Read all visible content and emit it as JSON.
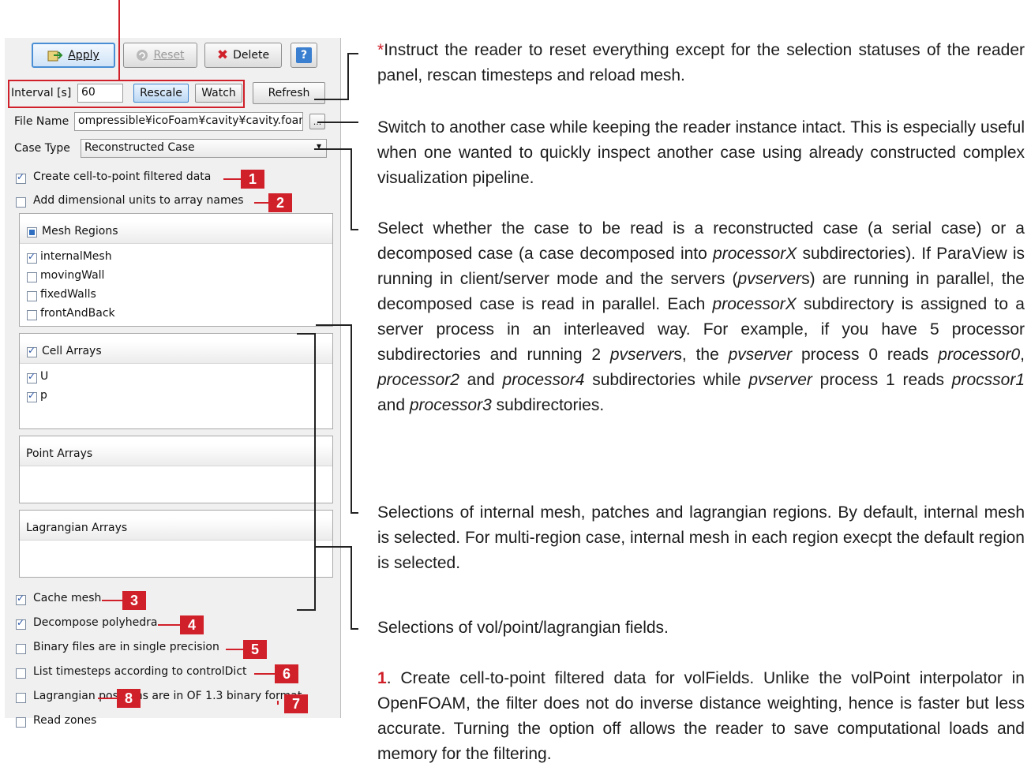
{
  "colors": {
    "accent_red": "#d0202a",
    "select_blue": "#3f86cf",
    "panel_bg": "#f0f0f0"
  },
  "toolbar": {
    "apply_label": "Apply",
    "reset_label": "Reset",
    "delete_label": "Delete",
    "help_label": "?"
  },
  "interval": {
    "label": "Interval [s]",
    "value": "60",
    "rescale_label": "Rescale",
    "watch_label": "Watch"
  },
  "refresh_label": "Refresh",
  "file": {
    "label": "File Name",
    "value": "ompressible¥icoFoam¥cavity¥cavity.foam",
    "browse_label": "..."
  },
  "case_type": {
    "label": "Case Type",
    "value": "Reconstructed Case"
  },
  "options": {
    "cell_to_point": "Create cell-to-point filtered data",
    "dim_units": "Add dimensional units to array names",
    "cache_mesh": "Cache mesh",
    "decompose_poly": "Decompose polyhedra",
    "binary_single": "Binary files are in single precision",
    "list_timesteps": "List timesteps according to controlDict",
    "lagrangian_positions": "Lagrangian positions are in OF 1.3 binary format",
    "read_zones": "Read zones"
  },
  "mesh_regions": {
    "header": "Mesh Regions",
    "items": [
      "internalMesh",
      "movingWall",
      "fixedWalls",
      "frontAndBack"
    ]
  },
  "cell_arrays": {
    "header": "Cell Arrays",
    "items": [
      "U",
      "p"
    ]
  },
  "point_arrays": {
    "header": "Point Arrays"
  },
  "lagrangian_arrays": {
    "header": "Lagrangian Arrays"
  },
  "badges": [
    "1",
    "2",
    "3",
    "4",
    "5",
    "6",
    "7",
    "8"
  ],
  "annotations": {
    "refresh_star": "*",
    "refresh": "Instruct the reader to reset everything except for the selection statuses of the reader panel, rescan timesteps and reload mesh.",
    "file": "Switch to another case while keeping the reader instance intact. This is especially useful when one wanted to quickly inspect another case  using already constructed complex visualization pipeline.",
    "case_type_1": "Select whether  the case to be read is a reconstructed case (a serial case) or a decomposed case (a case decomposed into ",
    "case_type_em1": "processorX",
    "case_type_2": " subdirectories). If ParaView is running in client/server mode and the servers (",
    "case_type_em2": "pvserver",
    "case_type_3": "s) are running in parallel, the decomposed case is read in parallel. Each ",
    "case_type_em3": "processorX",
    "case_type_4": " subdirectory is assigned to a server process in an interleaved way. For example, if you have 5 processor subdirectories and running 2 ",
    "case_type_em4": "pvserver",
    "case_type_5": "s, the ",
    "case_type_em5": "pvserver",
    "case_type_6": " process 0 reads ",
    "case_type_em6": "processor0",
    "case_type_7": ", ",
    "case_type_em7": "processor2",
    "case_type_8": " and ",
    "case_type_em8": "processor4",
    "case_type_9": " subdirectories while ",
    "case_type_em9": "pvserver",
    "case_type_10": " process 1 reads ",
    "case_type_em10": "procssor1",
    "case_type_11": " and ",
    "case_type_em11": "processor3",
    "case_type_12": " subdirectories.",
    "regions": "Selections of internal mesh, patches and lagrangian regions. By default, internal mesh is selected. For multi-region case, internal mesh in each region execpt the default region is selected.",
    "fields": "Selections of vol/point/lagrangian fields.",
    "note1_num": "1",
    "note1": ". Create cell-to-point filtered data for volFields. Unlike the volPoint interpolator in OpenFOAM, the filter does not do inverse distance weighting, hence is faster but less accurate. Turning the option off allows the reader to save computational loads and memory for the filtering."
  }
}
